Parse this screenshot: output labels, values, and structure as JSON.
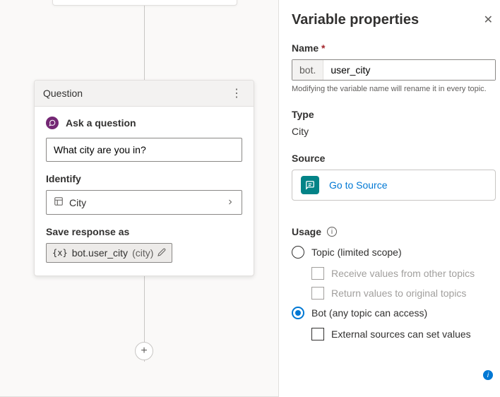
{
  "canvas": {
    "add_icon_glyph": "+"
  },
  "node": {
    "header_label": "Question",
    "title": "Ask a question",
    "prompt_value": "What city are you in?",
    "identify_label": "Identify",
    "identify_value": "City",
    "save_label": "Save response as",
    "variable_prefix": "{x}",
    "variable_name": "bot.user_city",
    "variable_type": "(city)"
  },
  "pane": {
    "title": "Variable properties",
    "name_label": "Name",
    "name_prefix": "bot.",
    "name_value": "user_city",
    "name_hint": "Modifying the variable name will rename it in every topic.",
    "type_label": "Type",
    "type_value": "City",
    "source_label": "Source",
    "source_link": "Go to Source",
    "usage_label": "Usage",
    "usage": {
      "topic_label": "Topic (limited scope)",
      "receive_label": "Receive values from other topics",
      "return_label": "Return values to original topics",
      "bot_label": "Bot (any topic can access)",
      "external_label": "External sources can set values",
      "selected": "bot"
    }
  }
}
